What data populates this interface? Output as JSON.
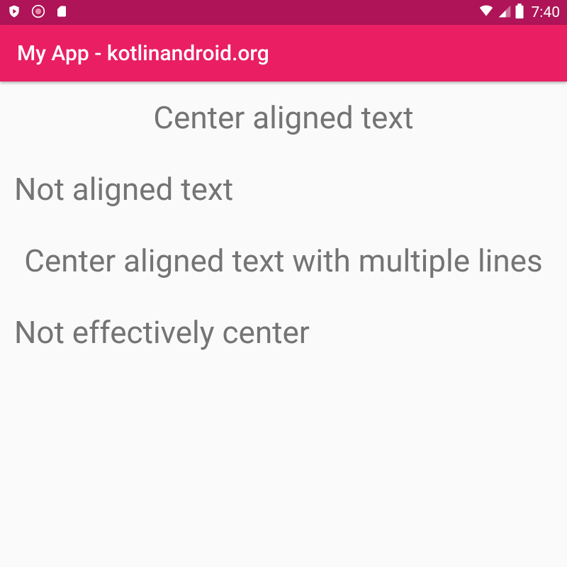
{
  "statusBar": {
    "clock": "7:40"
  },
  "appBar": {
    "title": "My App - kotlinandroid.org"
  },
  "content": {
    "text1": "Center aligned text",
    "text2": "Not aligned text",
    "text3": "Center aligned text with multiple lines",
    "text4": "Not effectively center"
  }
}
